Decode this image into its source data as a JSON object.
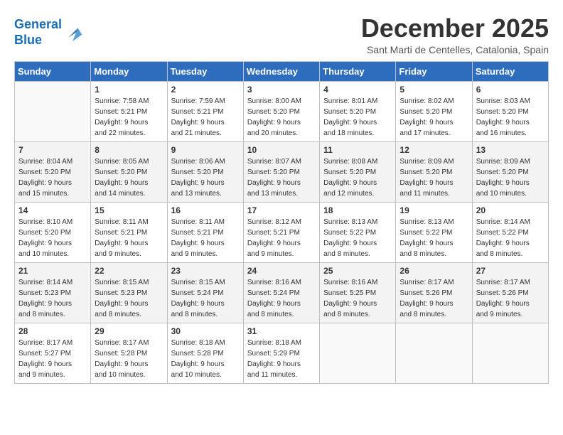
{
  "logo": {
    "line1": "General",
    "line2": "Blue"
  },
  "title": "December 2025",
  "location": "Sant Marti de Centelles, Catalonia, Spain",
  "weekdays": [
    "Sunday",
    "Monday",
    "Tuesday",
    "Wednesday",
    "Thursday",
    "Friday",
    "Saturday"
  ],
  "weeks": [
    [
      {
        "day": "",
        "info": ""
      },
      {
        "day": "1",
        "info": "Sunrise: 7:58 AM\nSunset: 5:21 PM\nDaylight: 9 hours\nand 22 minutes."
      },
      {
        "day": "2",
        "info": "Sunrise: 7:59 AM\nSunset: 5:21 PM\nDaylight: 9 hours\nand 21 minutes."
      },
      {
        "day": "3",
        "info": "Sunrise: 8:00 AM\nSunset: 5:20 PM\nDaylight: 9 hours\nand 20 minutes."
      },
      {
        "day": "4",
        "info": "Sunrise: 8:01 AM\nSunset: 5:20 PM\nDaylight: 9 hours\nand 18 minutes."
      },
      {
        "day": "5",
        "info": "Sunrise: 8:02 AM\nSunset: 5:20 PM\nDaylight: 9 hours\nand 17 minutes."
      },
      {
        "day": "6",
        "info": "Sunrise: 8:03 AM\nSunset: 5:20 PM\nDaylight: 9 hours\nand 16 minutes."
      }
    ],
    [
      {
        "day": "7",
        "info": "Sunrise: 8:04 AM\nSunset: 5:20 PM\nDaylight: 9 hours\nand 15 minutes."
      },
      {
        "day": "8",
        "info": "Sunrise: 8:05 AM\nSunset: 5:20 PM\nDaylight: 9 hours\nand 14 minutes."
      },
      {
        "day": "9",
        "info": "Sunrise: 8:06 AM\nSunset: 5:20 PM\nDaylight: 9 hours\nand 13 minutes."
      },
      {
        "day": "10",
        "info": "Sunrise: 8:07 AM\nSunset: 5:20 PM\nDaylight: 9 hours\nand 13 minutes."
      },
      {
        "day": "11",
        "info": "Sunrise: 8:08 AM\nSunset: 5:20 PM\nDaylight: 9 hours\nand 12 minutes."
      },
      {
        "day": "12",
        "info": "Sunrise: 8:09 AM\nSunset: 5:20 PM\nDaylight: 9 hours\nand 11 minutes."
      },
      {
        "day": "13",
        "info": "Sunrise: 8:09 AM\nSunset: 5:20 PM\nDaylight: 9 hours\nand 10 minutes."
      }
    ],
    [
      {
        "day": "14",
        "info": "Sunrise: 8:10 AM\nSunset: 5:20 PM\nDaylight: 9 hours\nand 10 minutes."
      },
      {
        "day": "15",
        "info": "Sunrise: 8:11 AM\nSunset: 5:21 PM\nDaylight: 9 hours\nand 9 minutes."
      },
      {
        "day": "16",
        "info": "Sunrise: 8:11 AM\nSunset: 5:21 PM\nDaylight: 9 hours\nand 9 minutes."
      },
      {
        "day": "17",
        "info": "Sunrise: 8:12 AM\nSunset: 5:21 PM\nDaylight: 9 hours\nand 9 minutes."
      },
      {
        "day": "18",
        "info": "Sunrise: 8:13 AM\nSunset: 5:22 PM\nDaylight: 9 hours\nand 8 minutes."
      },
      {
        "day": "19",
        "info": "Sunrise: 8:13 AM\nSunset: 5:22 PM\nDaylight: 9 hours\nand 8 minutes."
      },
      {
        "day": "20",
        "info": "Sunrise: 8:14 AM\nSunset: 5:22 PM\nDaylight: 9 hours\nand 8 minutes."
      }
    ],
    [
      {
        "day": "21",
        "info": "Sunrise: 8:14 AM\nSunset: 5:23 PM\nDaylight: 9 hours\nand 8 minutes."
      },
      {
        "day": "22",
        "info": "Sunrise: 8:15 AM\nSunset: 5:23 PM\nDaylight: 9 hours\nand 8 minutes."
      },
      {
        "day": "23",
        "info": "Sunrise: 8:15 AM\nSunset: 5:24 PM\nDaylight: 9 hours\nand 8 minutes."
      },
      {
        "day": "24",
        "info": "Sunrise: 8:16 AM\nSunset: 5:24 PM\nDaylight: 9 hours\nand 8 minutes."
      },
      {
        "day": "25",
        "info": "Sunrise: 8:16 AM\nSunset: 5:25 PM\nDaylight: 9 hours\nand 8 minutes."
      },
      {
        "day": "26",
        "info": "Sunrise: 8:17 AM\nSunset: 5:26 PM\nDaylight: 9 hours\nand 8 minutes."
      },
      {
        "day": "27",
        "info": "Sunrise: 8:17 AM\nSunset: 5:26 PM\nDaylight: 9 hours\nand 9 minutes."
      }
    ],
    [
      {
        "day": "28",
        "info": "Sunrise: 8:17 AM\nSunset: 5:27 PM\nDaylight: 9 hours\nand 9 minutes."
      },
      {
        "day": "29",
        "info": "Sunrise: 8:17 AM\nSunset: 5:28 PM\nDaylight: 9 hours\nand 10 minutes."
      },
      {
        "day": "30",
        "info": "Sunrise: 8:18 AM\nSunset: 5:28 PM\nDaylight: 9 hours\nand 10 minutes."
      },
      {
        "day": "31",
        "info": "Sunrise: 8:18 AM\nSunset: 5:29 PM\nDaylight: 9 hours\nand 11 minutes."
      },
      {
        "day": "",
        "info": ""
      },
      {
        "day": "",
        "info": ""
      },
      {
        "day": "",
        "info": ""
      }
    ]
  ]
}
